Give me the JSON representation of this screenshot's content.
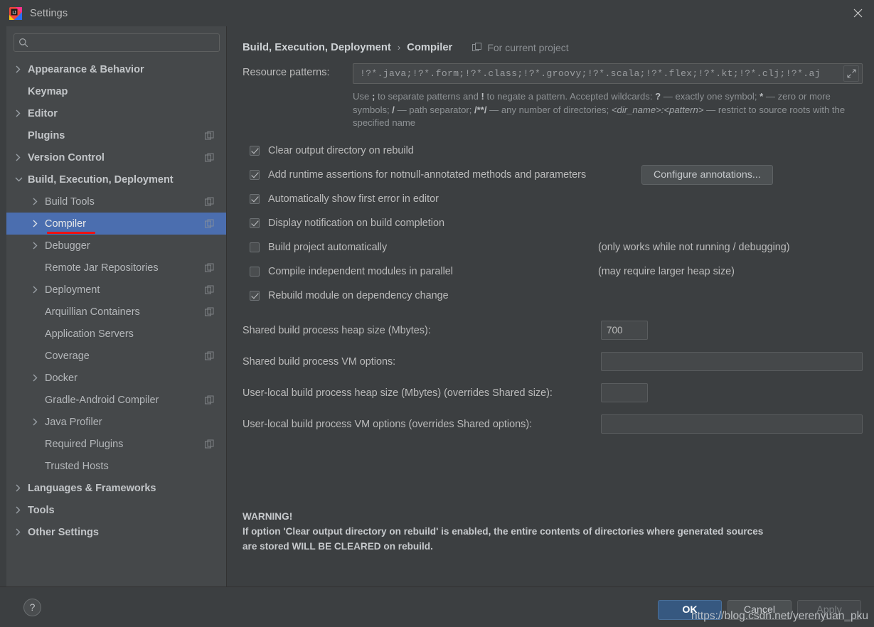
{
  "window": {
    "title": "Settings",
    "logo_icon": "intellij-idea-logo",
    "close_icon": "close-icon"
  },
  "sidebar": {
    "search": {
      "value": "",
      "placeholder": "",
      "icon": "search-icon"
    },
    "items": [
      {
        "label": "Appearance & Behavior",
        "level": "top",
        "expandable": true,
        "expanded": false,
        "project_icon": false,
        "selected": false
      },
      {
        "label": "Keymap",
        "level": "top",
        "expandable": false,
        "expanded": false,
        "project_icon": false,
        "selected": false
      },
      {
        "label": "Editor",
        "level": "top",
        "expandable": true,
        "expanded": false,
        "project_icon": false,
        "selected": false
      },
      {
        "label": "Plugins",
        "level": "top",
        "expandable": false,
        "expanded": false,
        "project_icon": true,
        "selected": false
      },
      {
        "label": "Version Control",
        "level": "top",
        "expandable": true,
        "expanded": false,
        "project_icon": true,
        "selected": false
      },
      {
        "label": "Build, Execution, Deployment",
        "level": "top",
        "expandable": true,
        "expanded": true,
        "project_icon": false,
        "selected": false
      },
      {
        "label": "Build Tools",
        "level": "child",
        "expandable": true,
        "expanded": false,
        "project_icon": true,
        "selected": false
      },
      {
        "label": "Compiler",
        "level": "child",
        "expandable": true,
        "expanded": false,
        "project_icon": true,
        "selected": true,
        "annotated": true
      },
      {
        "label": "Debugger",
        "level": "child",
        "expandable": true,
        "expanded": false,
        "project_icon": false,
        "selected": false
      },
      {
        "label": "Remote Jar Repositories",
        "level": "child",
        "expandable": false,
        "expanded": false,
        "project_icon": true,
        "selected": false
      },
      {
        "label": "Deployment",
        "level": "child",
        "expandable": true,
        "expanded": false,
        "project_icon": true,
        "selected": false
      },
      {
        "label": "Arquillian Containers",
        "level": "child",
        "expandable": false,
        "expanded": false,
        "project_icon": true,
        "selected": false
      },
      {
        "label": "Application Servers",
        "level": "child",
        "expandable": false,
        "expanded": false,
        "project_icon": false,
        "selected": false
      },
      {
        "label": "Coverage",
        "level": "child",
        "expandable": false,
        "expanded": false,
        "project_icon": true,
        "selected": false
      },
      {
        "label": "Docker",
        "level": "child",
        "expandable": true,
        "expanded": false,
        "project_icon": false,
        "selected": false
      },
      {
        "label": "Gradle-Android Compiler",
        "level": "child",
        "expandable": false,
        "expanded": false,
        "project_icon": true,
        "selected": false
      },
      {
        "label": "Java Profiler",
        "level": "child",
        "expandable": true,
        "expanded": false,
        "project_icon": false,
        "selected": false
      },
      {
        "label": "Required Plugins",
        "level": "child",
        "expandable": false,
        "expanded": false,
        "project_icon": true,
        "selected": false
      },
      {
        "label": "Trusted Hosts",
        "level": "child",
        "expandable": false,
        "expanded": false,
        "project_icon": false,
        "selected": false
      },
      {
        "label": "Languages & Frameworks",
        "level": "top",
        "expandable": true,
        "expanded": false,
        "project_icon": false,
        "selected": false
      },
      {
        "label": "Tools",
        "level": "top",
        "expandable": true,
        "expanded": false,
        "project_icon": false,
        "selected": false
      },
      {
        "label": "Other Settings",
        "level": "top",
        "expandable": true,
        "expanded": false,
        "project_icon": false,
        "selected": false
      }
    ]
  },
  "main": {
    "breadcrumb": {
      "root": "Build, Execution, Deployment",
      "separator": "›",
      "leaf": "Compiler",
      "scope_label": "For current project",
      "scope_icon": "project-scope-icon"
    },
    "resource_patterns": {
      "label": "Resource patterns:",
      "value": "!?*.java;!?*.form;!?*.class;!?*.groovy;!?*.scala;!?*.flex;!?*.kt;!?*.clj;!?*.aj",
      "placeholder": "",
      "expand_icon": "expand-icon"
    },
    "hint_html": "Use <b>;</b> to separate patterns and <b>!</b> to negate a pattern. Accepted wildcards: <b>?</b> — exactly one symbol; <b>*</b> — zero or more symbols; <b>/</b> — path separator; <b>/**/</b> — any number of directories; <i>&lt;dir_name&gt;:&lt;pattern&gt;</i> — restrict to source roots with the specified name",
    "checkboxes": [
      {
        "label": "Clear output directory on rebuild",
        "checked": true,
        "note": "",
        "button": ""
      },
      {
        "label": "Add runtime assertions for notnull-annotated methods and parameters",
        "checked": true,
        "note": "",
        "button": "Configure annotations..."
      },
      {
        "label": "Automatically show first error in editor",
        "checked": true,
        "note": "",
        "button": ""
      },
      {
        "label": "Display notification on build completion",
        "checked": true,
        "note": "",
        "button": ""
      },
      {
        "label": "Build project automatically",
        "checked": false,
        "note": "(only works while not running / debugging)",
        "button": ""
      },
      {
        "label": "Compile independent modules in parallel",
        "checked": false,
        "note": "(may require larger heap size)",
        "button": ""
      },
      {
        "label": "Rebuild module on dependency change",
        "checked": true,
        "note": "",
        "button": ""
      }
    ],
    "fields": [
      {
        "label": "Shared build process heap size (Mbytes):",
        "value": "700",
        "placeholder": "",
        "size": "small"
      },
      {
        "label": "Shared build process VM options:",
        "value": "",
        "placeholder": "",
        "size": "wide"
      },
      {
        "label": "User-local build process heap size (Mbytes) (overrides Shared size):",
        "value": "",
        "placeholder": "",
        "size": "small"
      },
      {
        "label": "User-local build process VM options (overrides Shared options):",
        "value": "",
        "placeholder": "",
        "size": "wide"
      }
    ],
    "warning": {
      "line1": "WARNING!",
      "line2": "If option 'Clear output directory on rebuild' is enabled, the entire contents of directories where generated sources",
      "line3": "are stored WILL BE CLEARED on rebuild."
    }
  },
  "footer": {
    "help_label": "?",
    "help_icon": "help-icon",
    "ok_label": "OK",
    "cancel_label": "Cancel",
    "apply_label": "Apply"
  },
  "watermark": "https://blog.csdn.net/yerenyuan_pku",
  "colors": {
    "window_bg": "#3c3f41",
    "sidebar_bg": "#45484a",
    "selection_blue": "#4b6eaf",
    "primary_button": "#365880",
    "annotation_red": "#ee1111",
    "text": "#bbbbbb"
  }
}
